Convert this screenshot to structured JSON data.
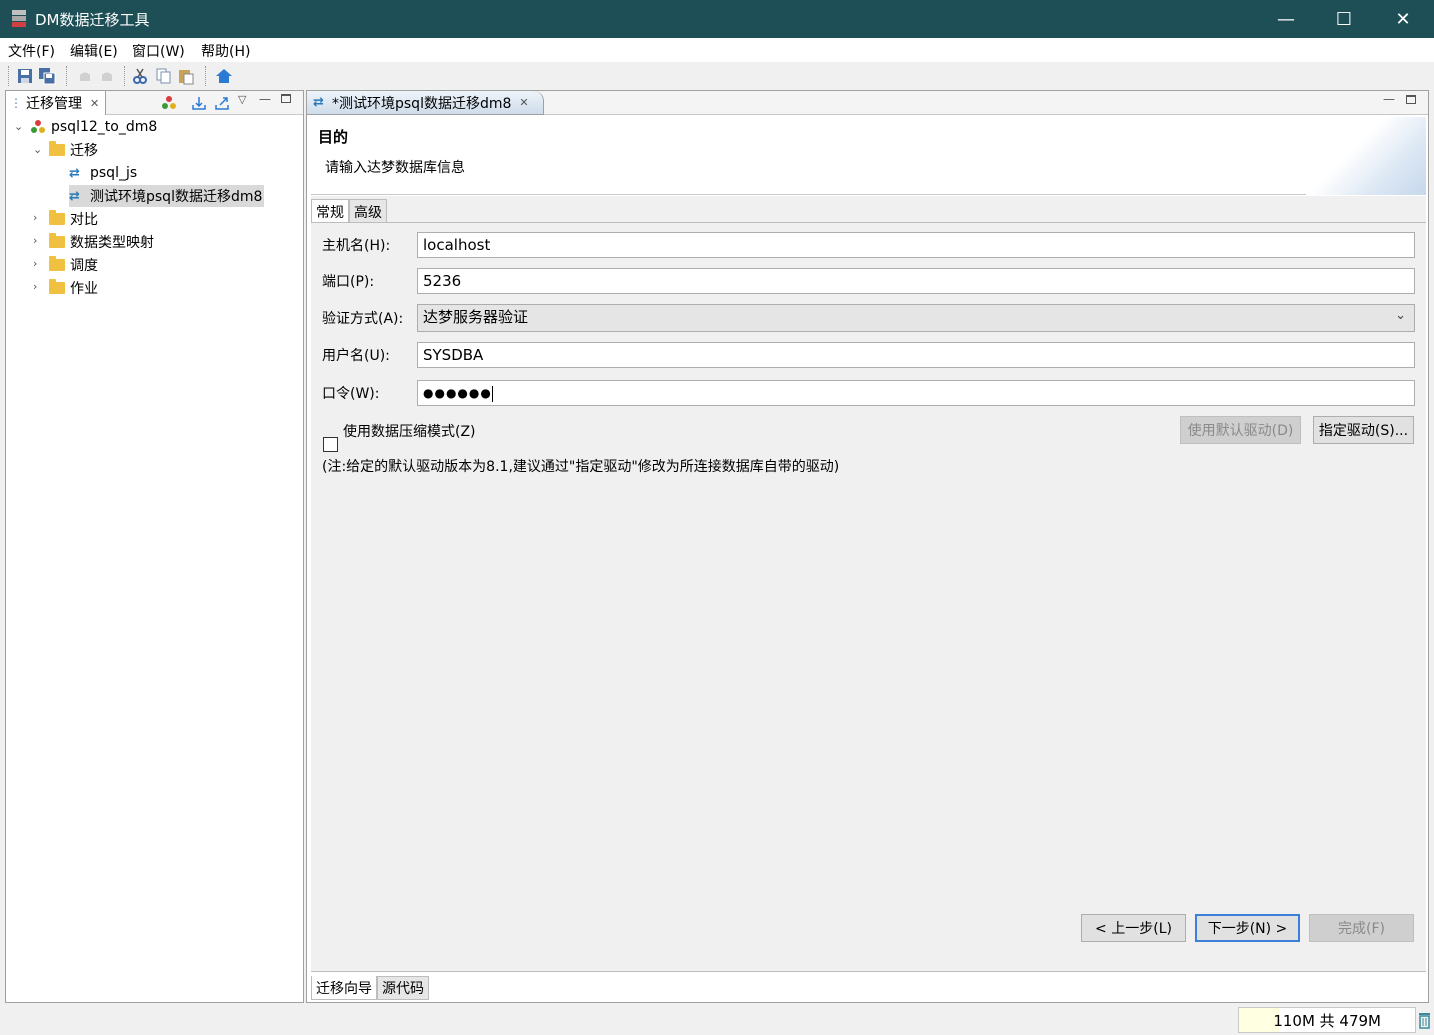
{
  "window": {
    "title": "DM数据迁移工具",
    "min": "—",
    "max": "☐",
    "close": "✕"
  },
  "menu": [
    "文件(F)",
    "编辑(E)",
    "窗口(W)",
    "帮助(H)"
  ],
  "left_view": {
    "tab_label": "迁移管理",
    "tree": {
      "project": "psql12_to_dm8",
      "migration_folder": "迁移",
      "migrations": [
        "psql_js",
        "测试环境psql数据迁移dm8"
      ],
      "folders": [
        "对比",
        "数据类型映射",
        "调度",
        "作业"
      ]
    }
  },
  "editor": {
    "tab_label": "*测试环境psql数据迁移dm8",
    "banner_title": "目的",
    "banner_subtitle": "请输入达梦数据库信息",
    "subtabs": [
      "常规",
      "高级"
    ],
    "fields": {
      "host_label": "主机名(H):",
      "host_value": "localhost",
      "port_label": "端口(P):",
      "port_value": "5236",
      "auth_label": "验证方式(A):",
      "auth_value": "达梦服务器验证",
      "user_label": "用户名(U):",
      "user_value": "SYSDBA",
      "password_label": "口令(W):",
      "password_value": "●●●●●●"
    },
    "compress_label": "使用数据压缩模式(Z)",
    "default_driver_button": "使用默认驱动(D)",
    "specify_driver_button": "指定驱动(S)...",
    "note": "(注:给定的默认驱动版本为8.1,建议通过\"指定驱动\"修改为所连接数据库自带的驱动)",
    "prev_button": "< 上一步(L)",
    "next_button": "下一步(N) >",
    "finish_button": "完成(F)",
    "bottom_tabs": [
      "迁移向导",
      "源代码"
    ]
  },
  "status": {
    "memory": "110M 共 479M",
    "memory_used_fraction": 0.23
  }
}
